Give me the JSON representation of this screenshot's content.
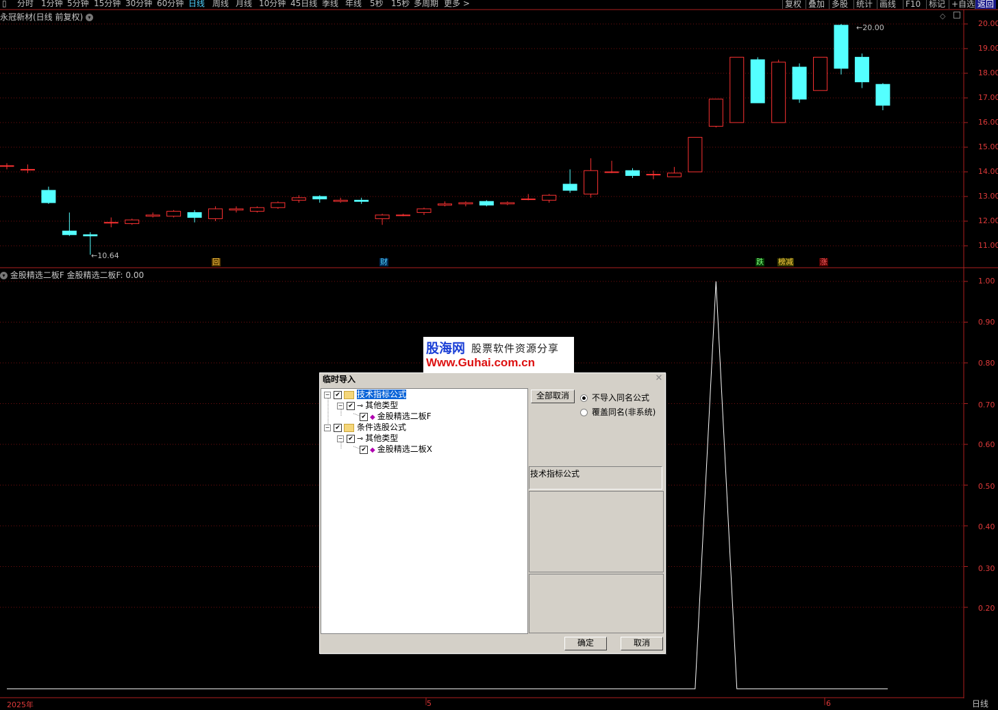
{
  "toolbar": {
    "periods": [
      {
        "label": "分时",
        "x": 25
      },
      {
        "label": "1分钟",
        "x": 60
      },
      {
        "label": "5分钟",
        "x": 98
      },
      {
        "label": "15分钟",
        "x": 137
      },
      {
        "label": "30分钟",
        "x": 183
      },
      {
        "label": "60分钟",
        "x": 229
      },
      {
        "label": "日线",
        "x": 275,
        "active": true
      },
      {
        "label": "周线",
        "x": 310
      },
      {
        "label": "月线",
        "x": 344
      },
      {
        "label": "10分钟",
        "x": 378
      },
      {
        "label": "45日线",
        "x": 424
      },
      {
        "label": "季线",
        "x": 470
      },
      {
        "label": "年线",
        "x": 504
      },
      {
        "label": "5秒",
        "x": 540
      },
      {
        "label": "15秒",
        "x": 571
      },
      {
        "label": "多周期",
        "x": 604
      },
      {
        "label": "更多 >",
        "x": 648
      }
    ],
    "right": [
      "复权",
      "叠加",
      "多股",
      "统计",
      "画线",
      "F10",
      "标记",
      "+自选",
      "返回"
    ]
  },
  "price_panel": {
    "title": "永冠新材(日线 前复权)",
    "axis": [
      "20.00",
      "19.00",
      "18.00",
      "17.00",
      "16.00",
      "15.00",
      "14.00",
      "13.00",
      "12.00",
      "11.00"
    ],
    "high_label": "20.00",
    "low_label": "10.64",
    "markers": [
      {
        "text": "回",
        "color": "#f0c040",
        "bg": "#5a3a00"
      },
      {
        "text": "财",
        "color": "#4fd2ff",
        "bg": "#002a55"
      },
      {
        "text": "跌",
        "color": "#7cff7c",
        "bg": "#003a00"
      },
      {
        "text": "榜减",
        "color": "#ffd040",
        "bg": "#3a3a00"
      },
      {
        "text": "涨",
        "color": "#ff6060",
        "bg": "#550000"
      }
    ]
  },
  "indicator_panel": {
    "title": "金股精选二板F  金股精选二板F: 0.00",
    "axis": [
      "1.00",
      "0.90",
      "0.80",
      "0.70",
      "0.60",
      "0.50",
      "0.40",
      "0.30",
      "0.20"
    ]
  },
  "xaxis": [
    "2025年",
    "5",
    "6"
  ],
  "period_label": "日线",
  "chart_data": {
    "type": "candlestick",
    "title": "永冠新材(日线 前复权)",
    "ylim": [
      10.3,
      20.3
    ],
    "candles": [
      {
        "o": 14.25,
        "c": 14.25,
        "h": 14.35,
        "l": 14.1
      },
      {
        "o": 14.1,
        "c": 14.1,
        "h": 14.3,
        "l": 13.95
      },
      {
        "o": 13.25,
        "c": 12.75,
        "h": 13.4,
        "l": 12.7
      },
      {
        "o": 11.6,
        "c": 11.45,
        "h": 12.35,
        "l": 11.4
      },
      {
        "o": 11.45,
        "c": 11.4,
        "h": 11.55,
        "l": 10.64
      },
      {
        "o": 11.95,
        "c": 11.95,
        "h": 12.15,
        "l": 11.75
      },
      {
        "o": 11.9,
        "c": 12.05,
        "h": 12.1,
        "l": 11.85
      },
      {
        "o": 12.2,
        "c": 12.25,
        "h": 12.35,
        "l": 12.15
      },
      {
        "o": 12.2,
        "c": 12.4,
        "h": 12.45,
        "l": 12.15
      },
      {
        "o": 12.35,
        "c": 12.15,
        "h": 12.45,
        "l": 11.95
      },
      {
        "o": 12.1,
        "c": 12.5,
        "h": 12.6,
        "l": 12.0
      },
      {
        "o": 12.45,
        "c": 12.5,
        "h": 12.6,
        "l": 12.35
      },
      {
        "o": 12.4,
        "c": 12.55,
        "h": 12.6,
        "l": 12.35
      },
      {
        "o": 12.55,
        "c": 12.75,
        "h": 12.8,
        "l": 12.5
      },
      {
        "o": 12.85,
        "c": 12.95,
        "h": 13.05,
        "l": 12.75
      },
      {
        "o": 13.0,
        "c": 12.9,
        "h": 13.05,
        "l": 12.75
      },
      {
        "o": 12.8,
        "c": 12.85,
        "h": 12.95,
        "l": 12.75
      },
      {
        "o": 12.85,
        "c": 12.8,
        "h": 12.95,
        "l": 12.7
      },
      {
        "o": 12.1,
        "c": 12.25,
        "h": 12.3,
        "l": 11.85
      },
      {
        "o": 12.25,
        "c": 12.25,
        "h": 12.3,
        "l": 12.2
      },
      {
        "o": 12.35,
        "c": 12.5,
        "h": 12.55,
        "l": 12.25
      },
      {
        "o": 12.65,
        "c": 12.7,
        "h": 12.8,
        "l": 12.6
      },
      {
        "o": 12.7,
        "c": 12.75,
        "h": 12.8,
        "l": 12.6
      },
      {
        "o": 12.8,
        "c": 12.65,
        "h": 12.85,
        "l": 12.6
      },
      {
        "o": 12.7,
        "c": 12.75,
        "h": 12.8,
        "l": 12.65
      },
      {
        "o": 12.9,
        "c": 12.9,
        "h": 13.1,
        "l": 12.85
      },
      {
        "o": 12.85,
        "c": 13.05,
        "h": 13.1,
        "l": 12.75
      },
      {
        "o": 13.5,
        "c": 13.25,
        "h": 14.1,
        "l": 13.15
      },
      {
        "o": 13.1,
        "c": 14.05,
        "h": 14.55,
        "l": 12.95
      },
      {
        "o": 14.0,
        "c": 14.0,
        "h": 14.45,
        "l": 13.95
      },
      {
        "o": 14.05,
        "c": 13.85,
        "h": 14.15,
        "l": 13.75
      },
      {
        "o": 13.9,
        "c": 13.9,
        "h": 14.05,
        "l": 13.7
      },
      {
        "o": 13.8,
        "c": 13.95,
        "h": 14.2,
        "l": 13.8
      },
      {
        "o": 14.0,
        "c": 15.4,
        "h": 15.4,
        "l": 14.0
      },
      {
        "o": 15.85,
        "c": 16.95,
        "h": 16.95,
        "l": 15.8
      },
      {
        "o": 16.0,
        "c": 18.65,
        "h": 18.65,
        "l": 16.0
      },
      {
        "o": 18.55,
        "c": 16.8,
        "h": 18.65,
        "l": 16.8
      },
      {
        "o": 16.0,
        "c": 18.45,
        "h": 18.55,
        "l": 16.0
      },
      {
        "o": 18.25,
        "c": 16.95,
        "h": 18.4,
        "l": 16.8
      },
      {
        "o": 17.3,
        "c": 18.65,
        "h": 18.65,
        "l": 17.3
      },
      {
        "o": 19.95,
        "c": 18.2,
        "h": 20.0,
        "l": 17.95
      },
      {
        "o": 18.65,
        "c": 17.65,
        "h": 18.8,
        "l": 17.4
      },
      {
        "o": 17.55,
        "c": 16.7,
        "h": 17.6,
        "l": 16.5
      }
    ],
    "indicator": {
      "name": "金股精选二板F",
      "ylim": [
        0,
        1.0
      ],
      "spike_index": 34,
      "values_default": 0.0,
      "spike_value": 1.0
    }
  },
  "dialog": {
    "title": "临时导入",
    "tree": [
      {
        "label": "技术指标公式",
        "level": 0,
        "type": "folder",
        "selected": true
      },
      {
        "label": "其他类型",
        "level": 1,
        "type": "key"
      },
      {
        "label": "金股精选二板F",
        "level": 2,
        "type": "item"
      },
      {
        "label": "条件选股公式",
        "level": 0,
        "type": "folder"
      },
      {
        "label": "其他类型",
        "level": 1,
        "type": "key"
      },
      {
        "label": "金股精选二板X",
        "level": 2,
        "type": "item"
      }
    ],
    "cancel_all": "全部取消",
    "radio_no_import": "不导入同名公式",
    "radio_overwrite": "覆盖同名(非系统)",
    "info_label": "技术指标公式",
    "ok": "确定",
    "cancel": "取消"
  },
  "logo": {
    "brand": "股海网",
    "slogan": "股票软件资源分享",
    "url": "Www.Guhai.com.cn"
  }
}
